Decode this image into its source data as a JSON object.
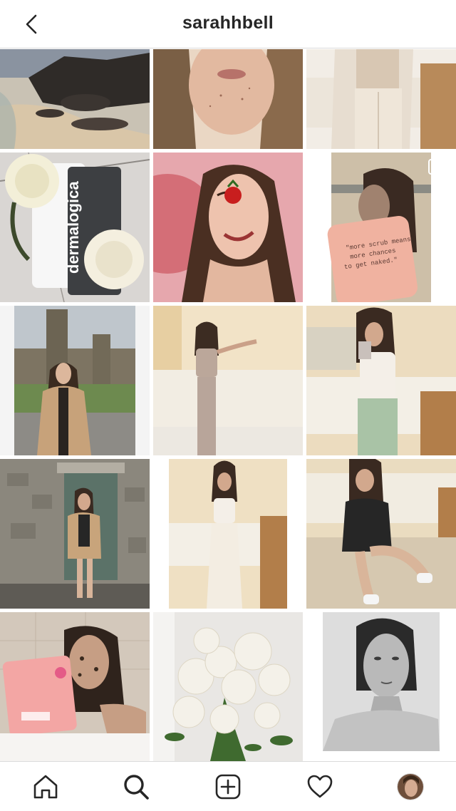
{
  "header": {
    "username": "sarahhbell",
    "back_icon": "chevron-left-icon"
  },
  "grid": {
    "posts": [
      {
        "subject": "rocky-beach"
      },
      {
        "subject": "face-closeup"
      },
      {
        "subject": "loungewear-bed"
      },
      {
        "subject": "dermalogica-roses"
      },
      {
        "subject": "strawberry-portrait"
      },
      {
        "subject": "coffee-scrub-mirror"
      },
      {
        "subject": "cathedral-coat"
      },
      {
        "subject": "mirror-selfie-grey"
      },
      {
        "subject": "mirror-selfie-green"
      },
      {
        "subject": "stone-doorway"
      },
      {
        "subject": "mirror-selfie-white"
      },
      {
        "subject": "sitting-floor-selfie"
      },
      {
        "subject": "bath-scrub"
      },
      {
        "subject": "white-roses"
      },
      {
        "subject": "bw-portrait"
      }
    ],
    "product_text": {
      "brand": "dermalogica",
      "pack_line1": "\"more scrub means",
      "pack_line2": "more chances",
      "pack_line3": "to get naked.\""
    }
  },
  "tabbar": {
    "items": [
      "home-icon",
      "search-icon",
      "new-post-icon",
      "activity-heart-icon",
      "profile-avatar"
    ]
  },
  "colors": {
    "text": "#262626",
    "divider": "#dbdbdb",
    "background": "#ffffff"
  }
}
